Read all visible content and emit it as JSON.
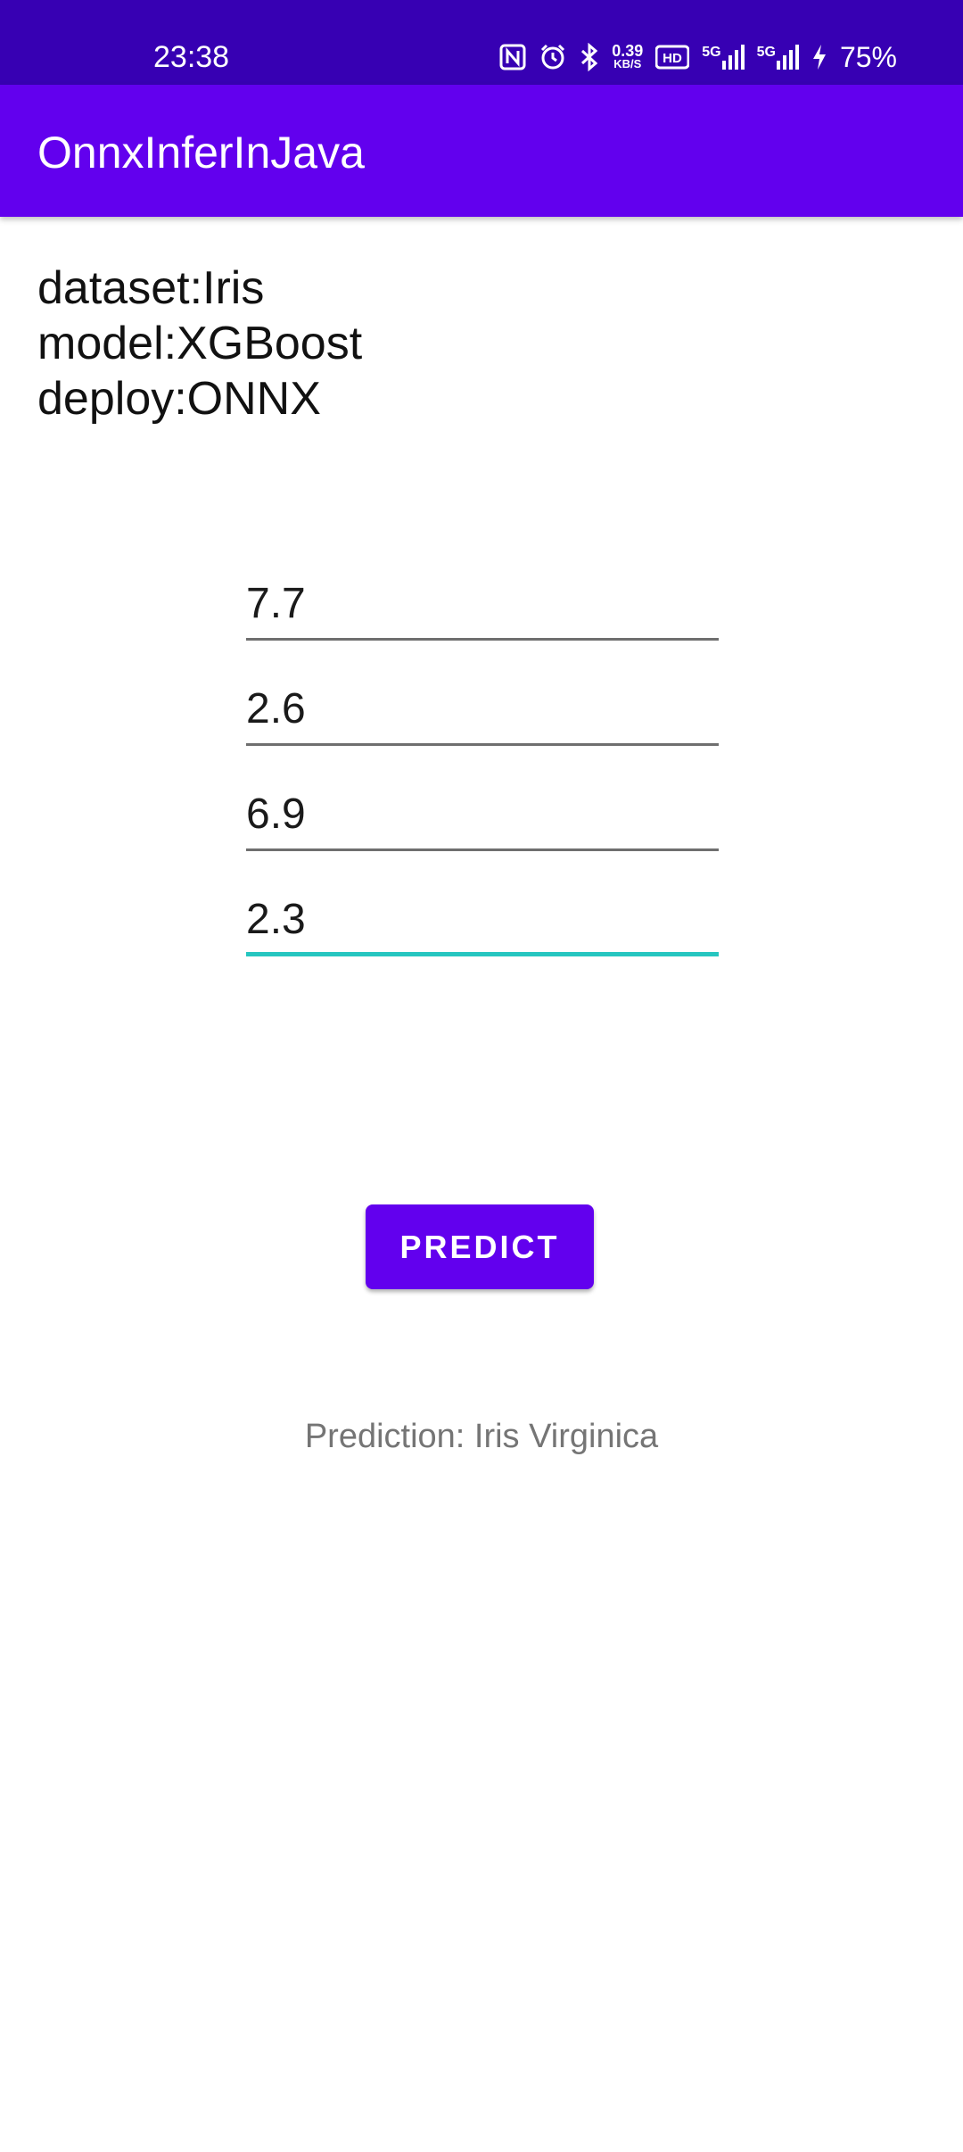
{
  "status_bar": {
    "time": "23:38",
    "speed_value": "0.39",
    "speed_unit": "KB/S",
    "network_1": "5G",
    "network_2": "5G",
    "battery": "75%",
    "icons": [
      "nfc-icon",
      "alarm-icon",
      "bluetooth-icon",
      "hd-icon",
      "signal-icon",
      "signal-icon",
      "charging-icon"
    ]
  },
  "app_bar": {
    "title": "OnnxInferInJava"
  },
  "info": {
    "dataset": "dataset:Iris",
    "model": "model:XGBoost",
    "deploy": "deploy:ONNX"
  },
  "inputs": {
    "field_1": "7.7",
    "field_2": "2.6",
    "field_3": "6.9",
    "field_4": "2.3"
  },
  "button": {
    "label": "PREDICT"
  },
  "result": {
    "text": "Prediction: Iris Virginica"
  },
  "colors": {
    "status_bar": "#3700b3",
    "primary": "#6200ee",
    "focus_underline": "#26c6c0",
    "result_text": "#757575"
  }
}
